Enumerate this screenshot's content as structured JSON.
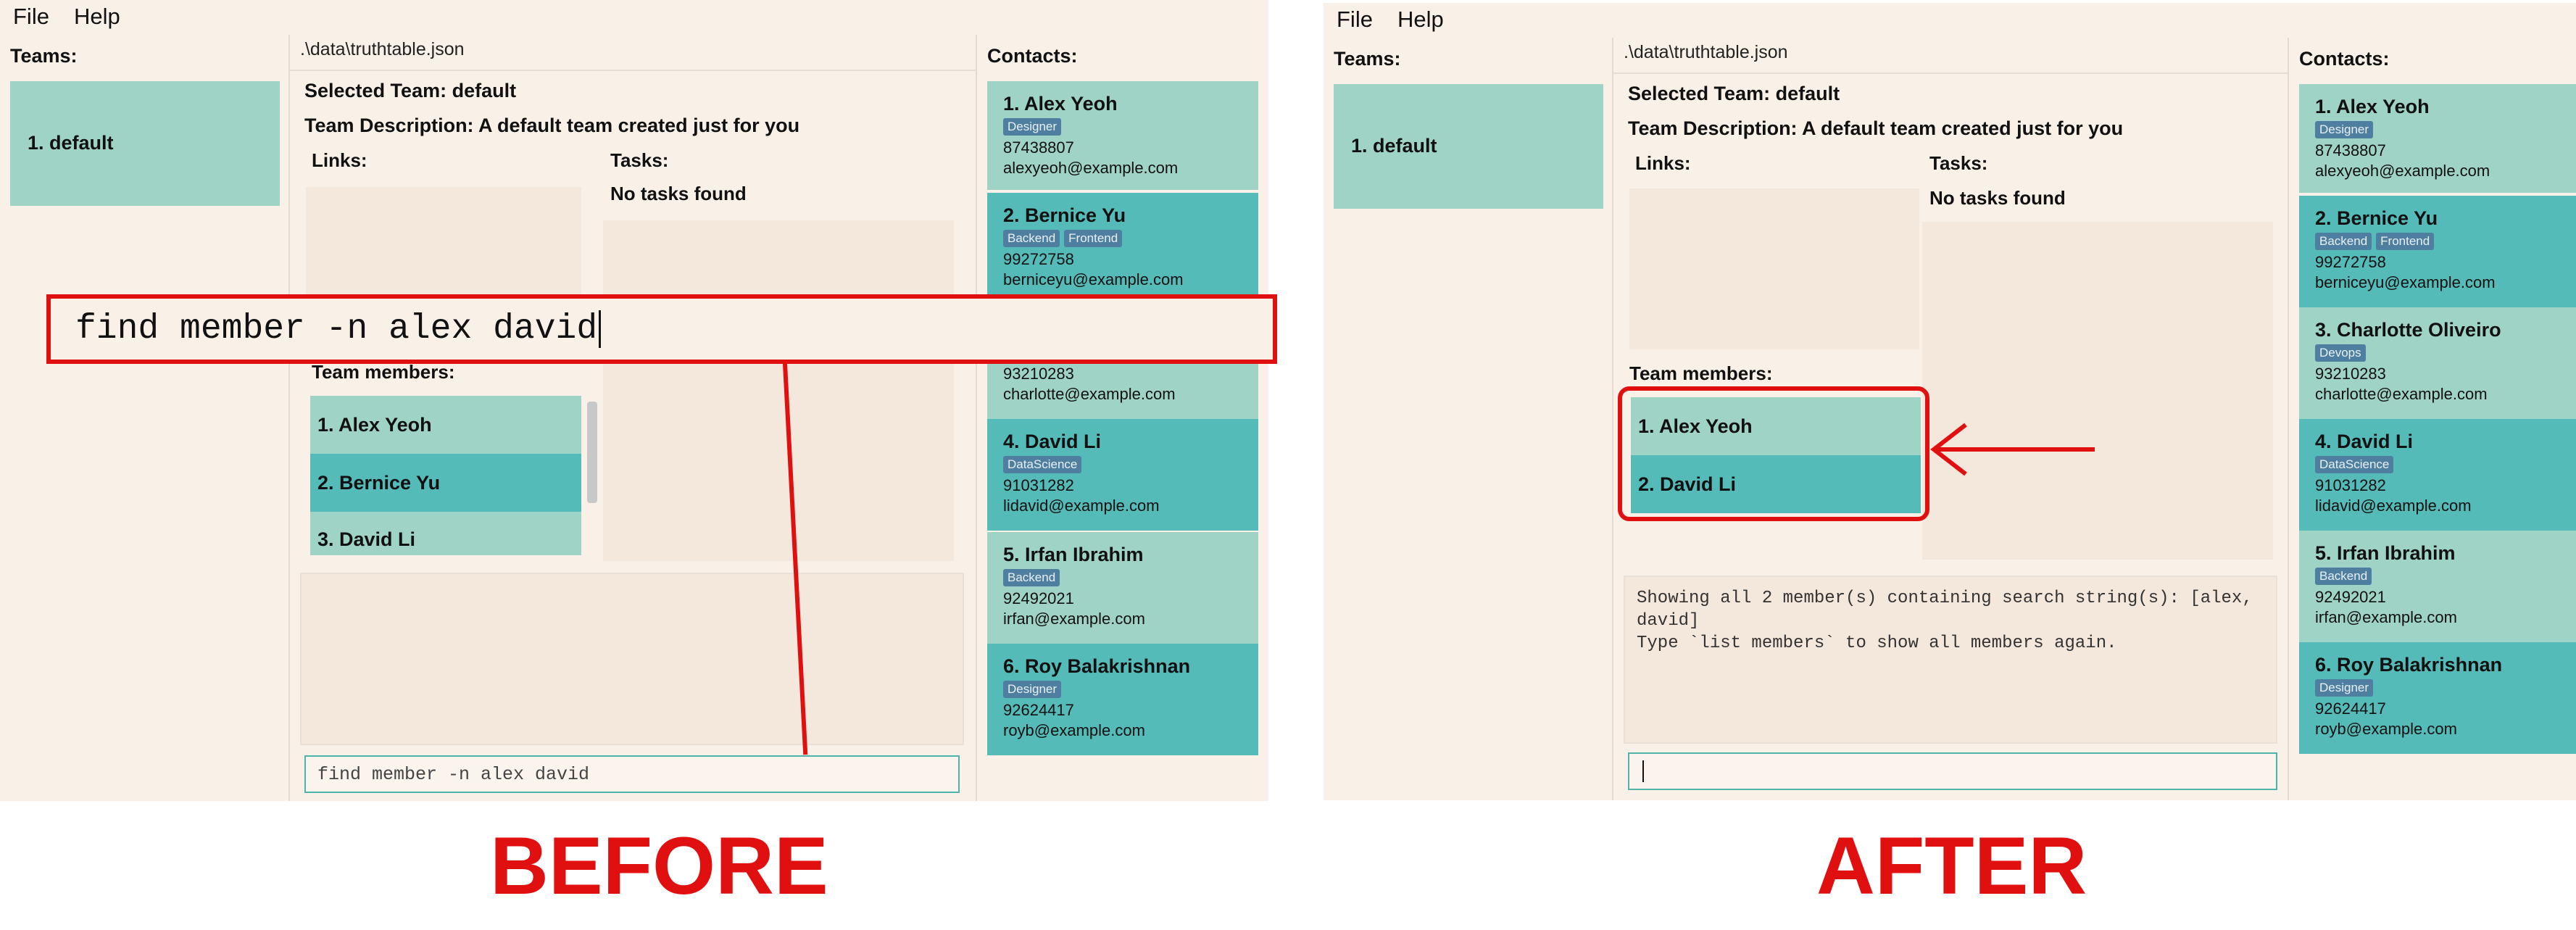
{
  "menu": [
    "File",
    "Help"
  ],
  "teams_title": "Teams:",
  "teams": [
    "1. default"
  ],
  "file_path": ".\\data\\truthtable.json",
  "selected_team": "Selected Team: default",
  "team_description": "Team Description: A default team created just for you",
  "links_label": "Links:",
  "tasks_label": "Tasks:",
  "no_tasks": "No tasks found",
  "team_members_label": "Team members:",
  "contacts_title": "Contacts:",
  "before": {
    "caption": "BEFORE",
    "members": [
      "1. Alex Yeoh",
      "2. Bernice Yu",
      "3. David Li"
    ],
    "command_input": "find member -n alex david",
    "command_zoom": "find member -n alex david",
    "result_text": ""
  },
  "after": {
    "caption": "AFTER",
    "members": [
      "1. Alex Yeoh",
      "2. David Li"
    ],
    "command_input": "",
    "result_line1": "Showing all 2 member(s) containing search string(s): [alex,",
    "result_line2": "david]",
    "result_line3": "Type `list members` to show all members again."
  },
  "contacts": [
    {
      "name": "1. Alex Yeoh",
      "tags": [
        "Designer"
      ],
      "phone": "87438807",
      "email": "alexyeoh@example.com"
    },
    {
      "name": "2. Bernice Yu",
      "tags": [
        "Backend",
        "Frontend"
      ],
      "phone": "99272758",
      "email": "berniceyu@example.com"
    },
    {
      "name": "3. Charlotte Oliveiro",
      "tags": [
        "Devops"
      ],
      "phone": "93210283",
      "email": "charlotte@example.com"
    },
    {
      "name": "4. David Li",
      "tags": [
        "DataScience"
      ],
      "phone": "91031282",
      "email": "lidavid@example.com"
    },
    {
      "name": "5. Irfan Ibrahim",
      "tags": [
        "Backend"
      ],
      "phone": "92492021",
      "email": "irfan@example.com"
    },
    {
      "name": "6. Roy Balakrishnan",
      "tags": [
        "Designer"
      ],
      "phone": "92624417",
      "email": "royb@example.com"
    }
  ],
  "colors": {
    "highlight_red": "#e01010",
    "card_light": "#9fd3c5",
    "card_dark": "#54bbb8",
    "background": "#f9f0e8"
  }
}
